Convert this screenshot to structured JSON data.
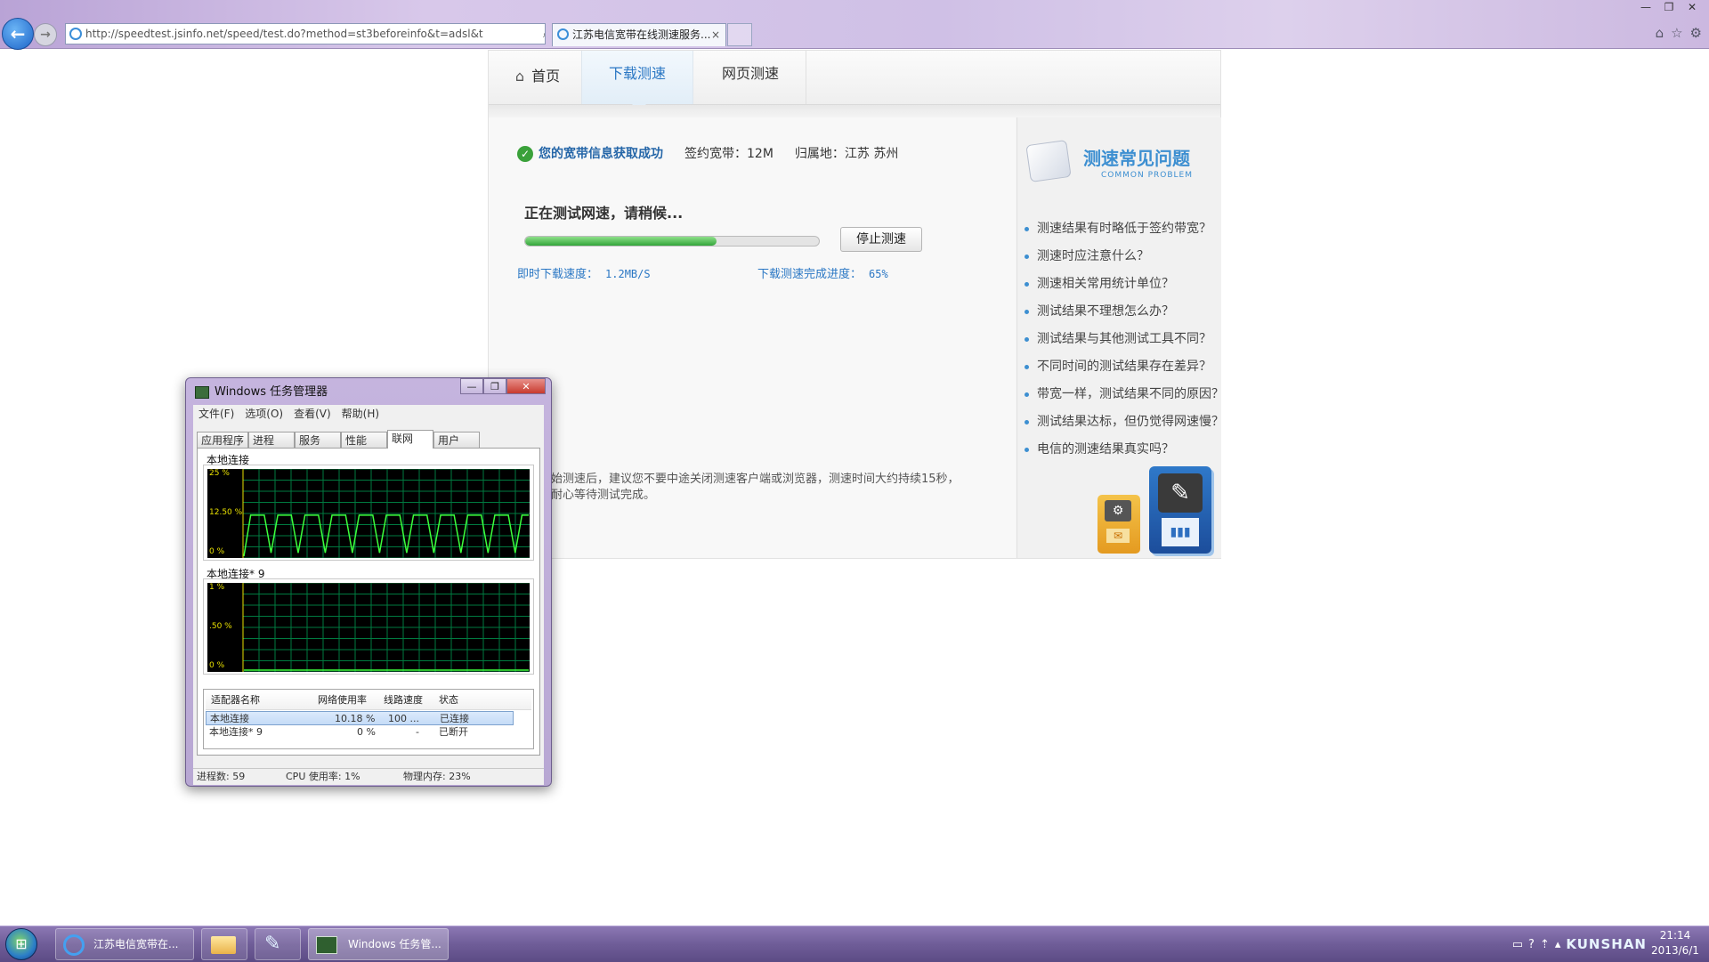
{
  "browser": {
    "url": "http://speedtest.jsinfo.net/speed/test.do?method=st3beforeinfo&t=adsl&t",
    "tab_title": "江苏电信宽带在线测速服务...",
    "tab_close": "×",
    "back_glyph": "←",
    "forward_glyph": "→",
    "addr_tools": [
      "⌕",
      "▾",
      "⊠",
      "↻",
      "✕"
    ],
    "window_controls": [
      "—",
      "❐",
      "✕"
    ],
    "right_icons": [
      "⌂",
      "☆",
      "⚙"
    ]
  },
  "site": {
    "nav": {
      "home": "首页",
      "download": "下载测速",
      "web": "网页测速"
    },
    "status": {
      "success": "您的宽带信息获取成功",
      "plan": "签约宽带：12M",
      "location": "归属地：江苏 苏州"
    },
    "testing_title": "正在测试网速，请稍候...",
    "progress_fraction": 0.65,
    "stop_button": "停止测速",
    "instant_speed_label": "即时下载速度：",
    "instant_speed_value": "1.2MB/S",
    "progress_label": "下载测速完成进度：",
    "progress_value": "65%",
    "notice_line1": "始测速后，建议您不要中途关闭测速客户端或浏览器，测速时间大约持续15秒，",
    "notice_line2": "耐心等待测试完成。",
    "faq": {
      "title": "测速常见问题",
      "subtitle": "COMMON PROBLEM",
      "items": [
        "测速结果有时略低于签约带宽？",
        "测速时应注意什么？",
        "测速相关常用统计单位？",
        "测试结果不理想怎么办？",
        "测试结果与其他测试工具不同？",
        "不同时间的测试结果存在差异？",
        "带宽一样，测试结果不同的原因？",
        "测试结果达标，但仍觉得网速慢？",
        "电信的测速结果真实吗？"
      ]
    }
  },
  "task_manager": {
    "title": "Windows 任务管理器",
    "controls": [
      "—",
      "❐",
      "✕"
    ],
    "menu": [
      "文件(F)",
      "选项(O)",
      "查看(V)",
      "帮助(H)"
    ],
    "tabs": [
      "应用程序",
      "进程",
      "服务",
      "性能",
      "联网",
      "用户"
    ],
    "active_tab_index": 4,
    "graphs": [
      {
        "label": "本地连接",
        "ticks": [
          "25 %",
          "12.50 %",
          "0 %"
        ],
        "max_percent": 25,
        "samples": [
          0,
          12,
          12,
          12,
          1,
          12,
          12,
          12,
          1,
          12,
          12,
          12,
          1,
          12,
          12,
          12,
          1,
          12,
          12,
          12,
          1,
          12,
          12,
          12,
          1,
          12,
          12,
          12,
          1,
          12,
          12,
          12,
          1,
          12,
          12,
          12,
          1,
          12,
          12,
          12,
          1,
          12,
          12
        ]
      },
      {
        "label": "本地连接* 9",
        "ticks": [
          "1 %",
          ".50 %",
          "0 %"
        ],
        "max_percent": 1,
        "samples": [
          0,
          0,
          0,
          0,
          0,
          0,
          0,
          0,
          0,
          0
        ]
      }
    ],
    "table": {
      "columns": [
        "适配器名称",
        "网络使用率",
        "线路速度",
        "状态"
      ],
      "rows": [
        [
          "本地连接",
          "10.18 %",
          "100 ...",
          "已连接"
        ],
        [
          "本地连接* 9",
          "0 %",
          "-",
          "已断开"
        ]
      ]
    },
    "status": {
      "processes": "进程数: 59",
      "cpu": "CPU 使用率: 1%",
      "memory": "物理内存: 23%"
    }
  },
  "taskbar": {
    "start_glyph": "⊞",
    "ie_label": "江苏电信宽带在...",
    "tm_label": "Windows 任务管...",
    "pin_glyph": "✎",
    "tray_icons": [
      "▭",
      "?",
      "⇡",
      "▴"
    ],
    "tray_brand": "KUNSHAN",
    "clock_time": "21:14",
    "clock_date": "2013/6/1"
  }
}
